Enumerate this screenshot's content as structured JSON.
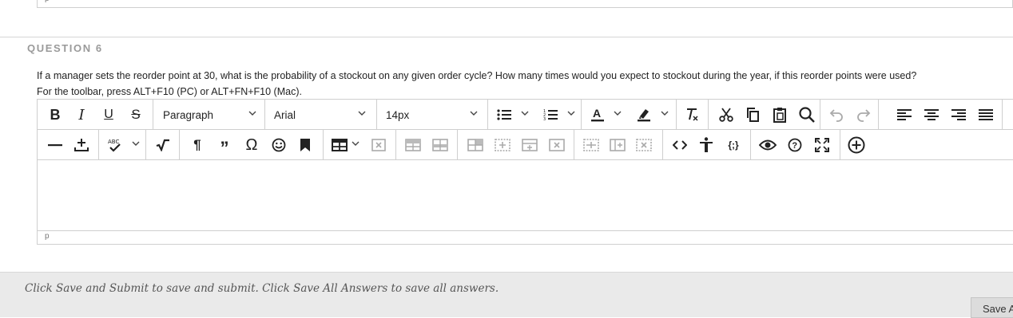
{
  "previous_editor": {
    "status_path": "p"
  },
  "question": {
    "title": "QUESTION 6",
    "text": "If a manager sets the reorder point at 30, what is the probability of a stockout on any given order cycle? How many times would you expect to stockout during the year, if this reorder points were used?",
    "toolbar_hint": "For the toolbar, press ALT+F10 (PC) or ALT+FN+F10 (Mac)."
  },
  "editor": {
    "paragraph_select": "Paragraph",
    "font_select": "Arial",
    "size_select": "14px",
    "status_path": "p",
    "content": ""
  },
  "toolbar_icons": {
    "row1": [
      "bold-icon",
      "italic-icon",
      "underline-icon",
      "strikethrough-icon",
      "bullet-list-icon",
      "numbered-list-icon",
      "text-color-icon",
      "highlight-icon",
      "clear-format-icon",
      "cut-icon",
      "copy-icon",
      "paste-icon",
      "find-icon",
      "undo-icon",
      "redo-icon",
      "align-left-icon",
      "align-center-icon",
      "align-right-icon",
      "justify-icon"
    ],
    "row2": [
      "horizontal-line-icon",
      "insert-plus-icon",
      "spellcheck-icon",
      "math-icon",
      "paragraph-mark-icon",
      "quote-icon",
      "omega-icon",
      "emoji-icon",
      "bookmark-icon",
      "table-icon",
      "delete-table-icon",
      "row-above-icon",
      "row-below-icon",
      "cell-props-icon",
      "insert-col-icon",
      "insert-row-icon",
      "delete-cell-icon",
      "merge-cells-icon",
      "split-cells-icon",
      "delete-col-icon",
      "code-icon",
      "accessibility-icon",
      "source-icon",
      "preview-icon",
      "help-icon",
      "fullscreen-icon",
      "add-content-icon"
    ]
  },
  "spellcheck_label": "ABC",
  "footer": {
    "instructions": "Click Save and Submit to save and submit. Click Save All Answers to save all answers.",
    "save_all_label": "Save A"
  },
  "colors": {
    "divider": "#d6d6d6",
    "title_gray": "#9a9a9a",
    "footer_bg": "#eaeaea",
    "disabled_icon": "#b5b5b5"
  }
}
